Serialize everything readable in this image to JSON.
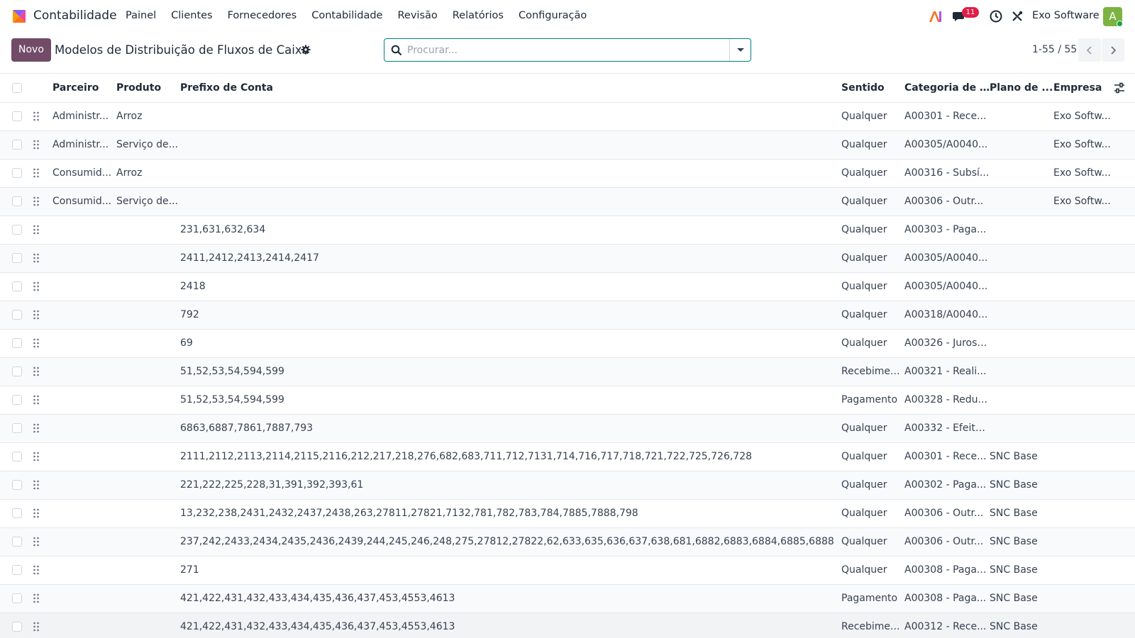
{
  "navbar": {
    "app_name": "Contabilidade",
    "menu": [
      "Painel",
      "Clientes",
      "Fornecedores",
      "Contabilidade",
      "Revisão",
      "Relatórios",
      "Configuração"
    ],
    "messages_badge": "11",
    "company": "Exo Software",
    "avatar_letter": "A"
  },
  "control": {
    "new_label": "Novo",
    "title": "Modelos de Distribuição de Fluxos de Caixa",
    "search_placeholder": "Procurar...",
    "pager": "1-55 / 55"
  },
  "table": {
    "columns": [
      "Parceiro",
      "Produto",
      "Prefixo de Conta",
      "Sentido",
      "Categoria de F...",
      "Plano de ...",
      "Empresa"
    ],
    "rows": [
      {
        "partner": "Administr...",
        "product": "Arroz",
        "prefix": "",
        "direction": "Qualquer",
        "category": "A00301 - Rece...",
        "plan": "",
        "company": "Exo Softw..."
      },
      {
        "partner": "Administr...",
        "product": "Serviço de...",
        "prefix": "",
        "direction": "Qualquer",
        "category": "A00305/A0040...",
        "plan": "",
        "company": "Exo Softw..."
      },
      {
        "partner": "Consumid...",
        "product": "Arroz",
        "prefix": "",
        "direction": "Qualquer",
        "category": "A00316 - Subsí...",
        "plan": "",
        "company": "Exo Softw..."
      },
      {
        "partner": "Consumid...",
        "product": "Serviço de...",
        "prefix": "",
        "direction": "Qualquer",
        "category": "A00306 - Outr...",
        "plan": "",
        "company": "Exo Softw..."
      },
      {
        "partner": "",
        "product": "",
        "prefix": "231,631,632,634",
        "direction": "Qualquer",
        "category": "A00303 - Paga...",
        "plan": "",
        "company": ""
      },
      {
        "partner": "",
        "product": "",
        "prefix": "2411,2412,2413,2414,2417",
        "direction": "Qualquer",
        "category": "A00305/A0040...",
        "plan": "",
        "company": ""
      },
      {
        "partner": "",
        "product": "",
        "prefix": "2418",
        "direction": "Qualquer",
        "category": "A00305/A0040...",
        "plan": "",
        "company": ""
      },
      {
        "partner": "",
        "product": "",
        "prefix": "792",
        "direction": "Qualquer",
        "category": "A00318/A0040...",
        "plan": "",
        "company": ""
      },
      {
        "partner": "",
        "product": "",
        "prefix": "69",
        "direction": "Qualquer",
        "category": "A00326 - Juros ...",
        "plan": "",
        "company": ""
      },
      {
        "partner": "",
        "product": "",
        "prefix": "51,52,53,54,594,599",
        "direction": "Recebime...",
        "category": "A00321 - Reali...",
        "plan": "",
        "company": ""
      },
      {
        "partner": "",
        "product": "",
        "prefix": "51,52,53,54,594,599",
        "direction": "Pagamento",
        "category": "A00328 - Redu...",
        "plan": "",
        "company": ""
      },
      {
        "partner": "",
        "product": "",
        "prefix": "6863,6887,7861,7887,793",
        "direction": "Qualquer",
        "category": "A00332 - Efeito...",
        "plan": "",
        "company": ""
      },
      {
        "partner": "",
        "product": "",
        "prefix": "2111,2112,2113,2114,2115,2116,212,217,218,276,682,683,711,712,7131,714,716,717,718,721,722,725,726,728",
        "direction": "Qualquer",
        "category": "A00301 - Rece...",
        "plan": "SNC Base",
        "company": ""
      },
      {
        "partner": "",
        "product": "",
        "prefix": "221,222,225,228,31,391,392,393,61",
        "direction": "Qualquer",
        "category": "A00302 - Paga...",
        "plan": "SNC Base",
        "company": ""
      },
      {
        "partner": "",
        "product": "",
        "prefix": "13,232,238,2431,2432,2437,2438,263,27811,27821,7132,781,782,783,784,7885,7888,798",
        "direction": "Qualquer",
        "category": "A00306 - Outr...",
        "plan": "SNC Base",
        "company": ""
      },
      {
        "partner": "",
        "product": "",
        "prefix": "237,242,2433,2434,2435,2436,2439,244,245,246,248,275,27812,27822,62,633,635,636,637,638,681,6882,6883,6884,6885,6888",
        "direction": "Qualquer",
        "category": "A00306 - Outr...",
        "plan": "SNC Base",
        "company": ""
      },
      {
        "partner": "",
        "product": "",
        "prefix": "271",
        "direction": "Qualquer",
        "category": "A00308 - Paga...",
        "plan": "SNC Base",
        "company": ""
      },
      {
        "partner": "",
        "product": "",
        "prefix": "421,422,431,432,433,434,435,436,437,453,4553,4613",
        "direction": "Pagamento",
        "category": "A00308 - Paga...",
        "plan": "SNC Base",
        "company": ""
      },
      {
        "partner": "",
        "product": "",
        "prefix": "421,422,431,432,433,434,435,436,437,453,4553,4613",
        "direction": "Recebime...",
        "category": "A00312 - Rece...",
        "plan": "SNC Base",
        "company": ""
      }
    ]
  }
}
